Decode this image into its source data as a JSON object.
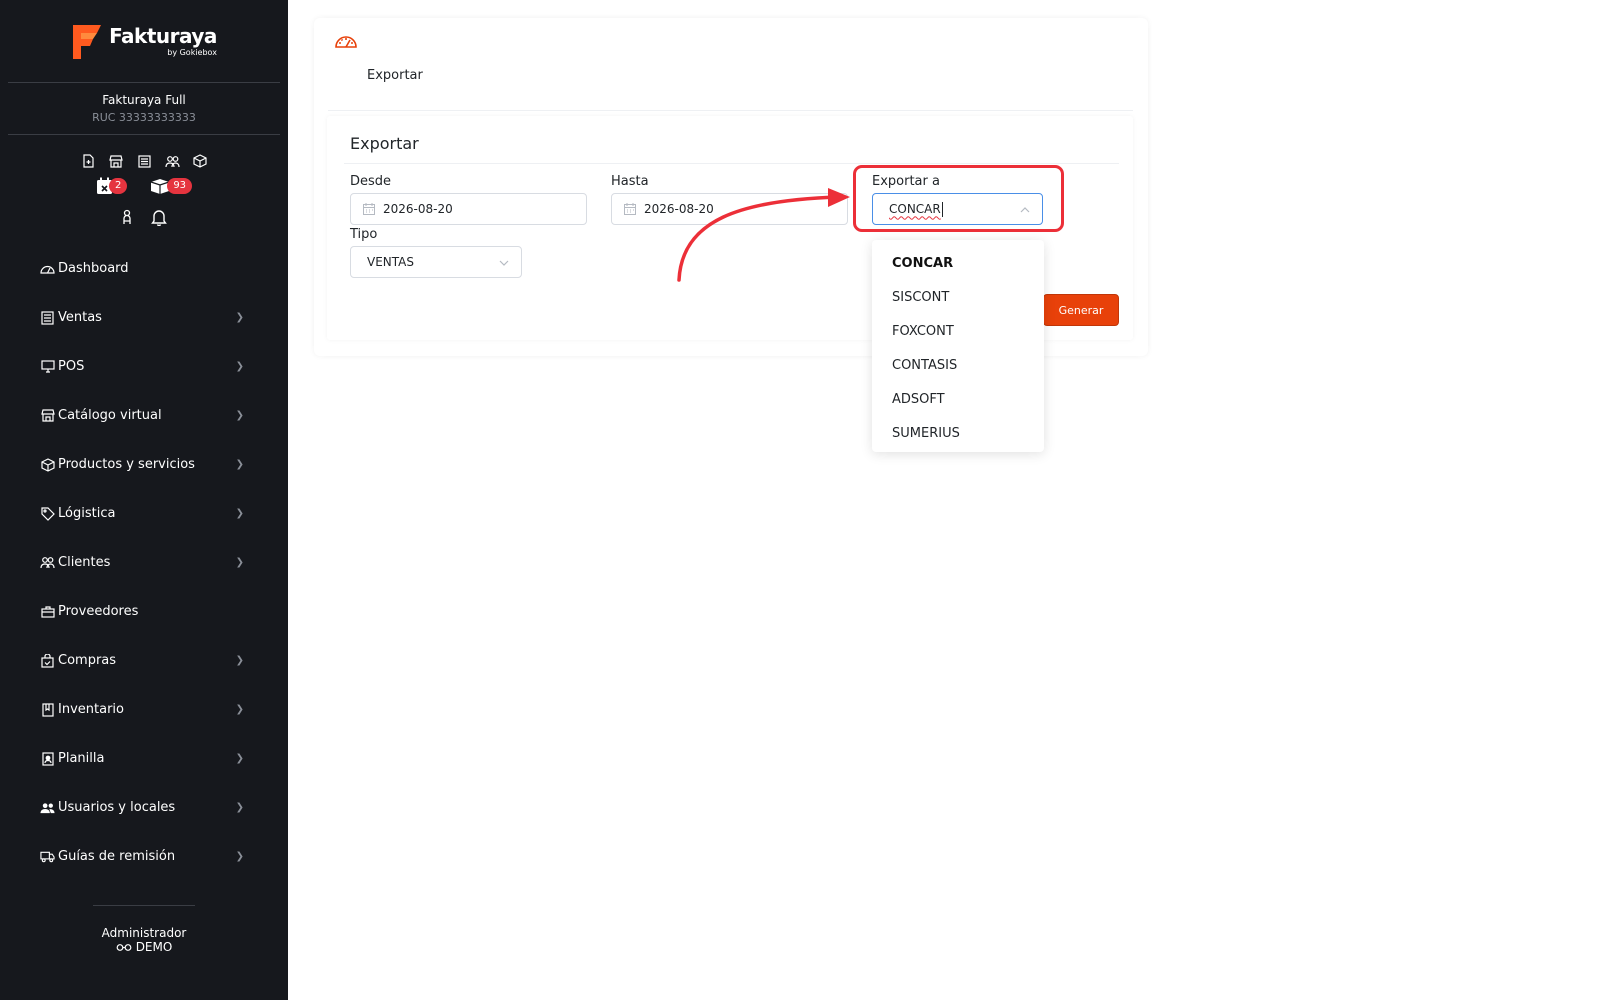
{
  "brand": {
    "name_main": "Fakturaya",
    "by": "by Gokiebox"
  },
  "company": {
    "name": "Fakturaya Full",
    "ruc": "RUC 33333333333"
  },
  "quick_icons": [
    "file-plus-icon",
    "store-icon",
    "receipt-icon",
    "users-icon",
    "box-icon"
  ],
  "badges": [
    {
      "icon": "calendar-x-icon",
      "count": "2"
    },
    {
      "icon": "boxes-icon",
      "count": "93"
    }
  ],
  "menu": [
    {
      "label": "Dashboard",
      "icon": "dashboard-icon",
      "chevron": false
    },
    {
      "label": "Ventas",
      "icon": "receipt-icon",
      "chevron": true
    },
    {
      "label": "POS",
      "icon": "monitor-icon",
      "chevron": true
    },
    {
      "label": "Catálogo virtual",
      "icon": "store-icon",
      "chevron": true
    },
    {
      "label": "Productos y servicios",
      "icon": "box-icon",
      "chevron": true
    },
    {
      "label": "Lógistica",
      "icon": "tag-icon",
      "chevron": true
    },
    {
      "label": "Clientes",
      "icon": "users-icon",
      "chevron": true
    },
    {
      "label": "Proveedores",
      "icon": "briefcase-icon",
      "chevron": false
    },
    {
      "label": "Compras",
      "icon": "shopping-bag-icon",
      "chevron": true
    },
    {
      "label": "Inventario",
      "icon": "book-icon",
      "chevron": true
    },
    {
      "label": "Planilla",
      "icon": "id-card-icon",
      "chevron": true
    },
    {
      "label": "Usuarios y locales",
      "icon": "user-group-icon",
      "chevron": true
    },
    {
      "label": "Guías de remisión",
      "icon": "truck-icon",
      "chevron": true
    }
  ],
  "footer": {
    "role": "Administrador",
    "user": "DEMO"
  },
  "page": {
    "title": "Exportar"
  },
  "form": {
    "section_title": "Exportar",
    "desde_label": "Desde",
    "desde_value": "2026-08-20",
    "hasta_label": "Hasta",
    "hasta_value": "2026-08-20",
    "exportar_label": "Exportar a",
    "exportar_value": "CONCAR",
    "tipo_label": "Tipo",
    "tipo_value": "VENTAS",
    "generate_label": "Generar"
  },
  "dropdown_options": [
    "CONCAR",
    "SISCONT",
    "FOXCONT",
    "CONTASIS",
    "ADSOFT",
    "SUMERIUS"
  ],
  "colors": {
    "accent": "#e8410a",
    "sidebar": "#16181d",
    "annotation": "#ec2f38",
    "badge": "#e5343f"
  }
}
